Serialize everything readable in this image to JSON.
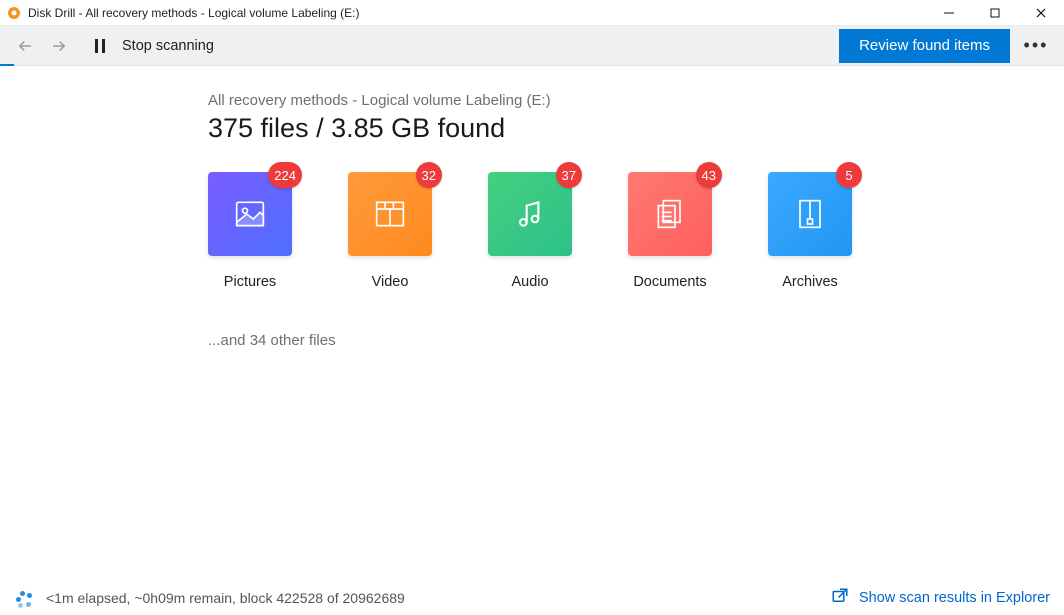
{
  "window": {
    "title": "Disk Drill - All recovery methods - Logical volume Labeling (E:)"
  },
  "toolbar": {
    "stop_label": "Stop scanning",
    "review_label": "Review found items"
  },
  "content": {
    "subtitle": "All recovery methods - Logical volume Labeling (E:)",
    "headline": "375 files / 3.85 GB found",
    "other_files": "...and 34 other files"
  },
  "tiles": [
    {
      "label": "Pictures",
      "count": "224",
      "style": "grad-purple",
      "icon": "image"
    },
    {
      "label": "Video",
      "count": "32",
      "style": "grad-orange",
      "icon": "film"
    },
    {
      "label": "Audio",
      "count": "37",
      "style": "grad-green",
      "icon": "music"
    },
    {
      "label": "Documents",
      "count": "43",
      "style": "grad-red",
      "icon": "document"
    },
    {
      "label": "Archives",
      "count": "5",
      "style": "grad-blue",
      "icon": "archive"
    }
  ],
  "footer": {
    "status": "<1m elapsed, ~0h09m remain, block 422528 of 20962689",
    "explorer_link": "Show scan results in Explorer"
  }
}
